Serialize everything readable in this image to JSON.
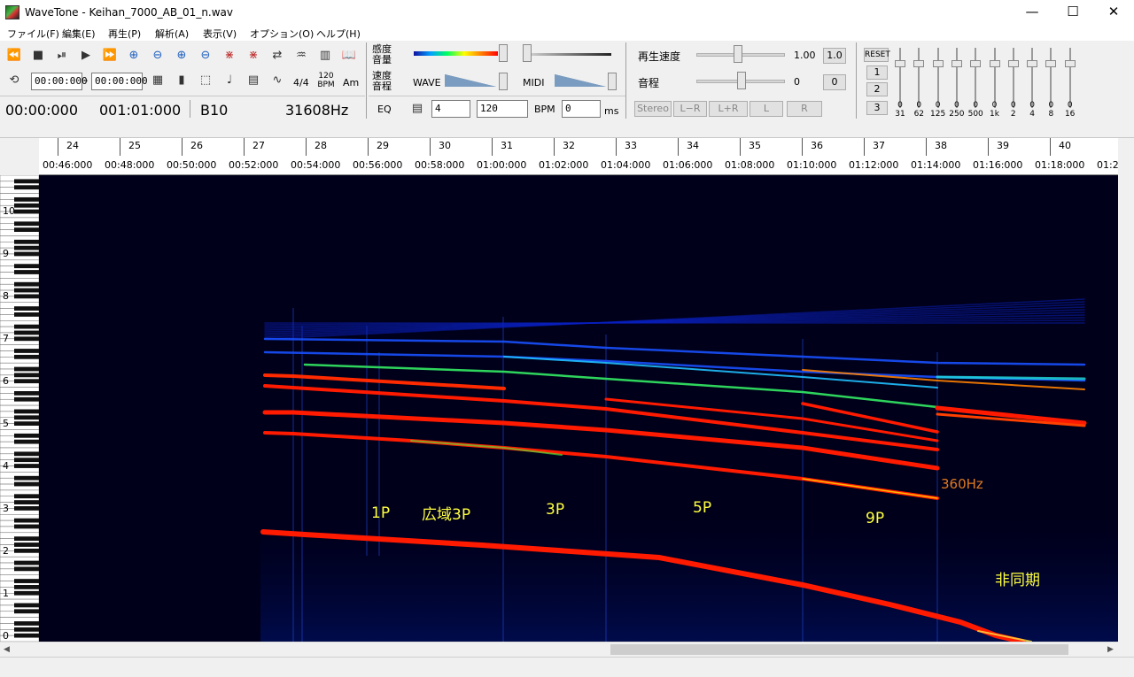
{
  "window": {
    "title": "WaveTone - Keihan_7000_AB_01_n.wav",
    "minimize": "—",
    "maximize": "☐",
    "close": "✕"
  },
  "menu": [
    "ファイル(F)",
    "編集(E)",
    "再生(P)",
    "解析(A)",
    "表示(V)",
    "オプション(O)",
    "ヘルプ(H)"
  ],
  "toolbar": {
    "time_start": "00:00:000",
    "time_sep": "–",
    "time_end": "00:00:000",
    "meter": "4/4",
    "bpm_icon_top": "120",
    "bpm_icon_bottom": "BPM",
    "am": "Am",
    "current_time": "00:00:000",
    "current_beat": "001:01:000",
    "current_note": "B10",
    "current_freq": "31608Hz"
  },
  "display": {
    "sensitivity_label_1": "感度",
    "sensitivity_label_2": "音量",
    "speed_label_1": "速度",
    "speed_label_2": "音程",
    "wave_label": "WAVE",
    "midi_label": "MIDI",
    "eq_label": "EQ",
    "beats_value": "4",
    "bpm_value": "120",
    "bpm_label": "BPM",
    "ms_value": "0",
    "ms_label": "ms"
  },
  "playback": {
    "speed_label": "再生速度",
    "speed_value": "1.00",
    "speed_reset": "1.0",
    "pitch_label": "音程",
    "pitch_value": "0",
    "pitch_reset": "0",
    "stereo": "Stereo",
    "lr_minus": "L−R",
    "lr_plus": "L+R",
    "l": "L",
    "r": "R"
  },
  "eq": {
    "reset": "RESET",
    "presets": [
      "1",
      "2",
      "3"
    ],
    "bands": [
      {
        "value": "0",
        "freq": "31"
      },
      {
        "value": "0",
        "freq": "62"
      },
      {
        "value": "0",
        "freq": "125"
      },
      {
        "value": "0",
        "freq": "250"
      },
      {
        "value": "0",
        "freq": "500"
      },
      {
        "value": "0",
        "freq": "1k"
      },
      {
        "value": "0",
        "freq": "2"
      },
      {
        "value": "0",
        "freq": "4"
      },
      {
        "value": "0",
        "freq": "8"
      },
      {
        "value": "0",
        "freq": "16"
      }
    ]
  },
  "ruler": {
    "bars": [
      "24",
      "25",
      "26",
      "27",
      "28",
      "29",
      "30",
      "31",
      "32",
      "33",
      "34",
      "35",
      "36",
      "37",
      "38",
      "39",
      "40"
    ],
    "times": [
      "00:46:000",
      "00:48:000",
      "00:50:000",
      "00:52:000",
      "00:54:000",
      "00:56:000",
      "00:58:000",
      "01:00:000",
      "01:02:000",
      "01:04:000",
      "01:06:000",
      "01:08:000",
      "01:10:000",
      "01:12:000",
      "01:14:000",
      "01:16:000",
      "01:18:000",
      "01:2"
    ]
  },
  "piano_octaves": [
    "10",
    "9",
    "8",
    "7",
    "6",
    "5",
    "4",
    "3",
    "2",
    "1",
    "0"
  ],
  "annotations": [
    {
      "text": "1P",
      "color": "#ffff40"
    },
    {
      "text": "広域3P",
      "color": "#ffff40"
    },
    {
      "text": "3P",
      "color": "#ffff40"
    },
    {
      "text": "5P",
      "color": "#ffff40"
    },
    {
      "text": "9P",
      "color": "#ffff40"
    },
    {
      "text": "360Hz",
      "color": "#e07a20"
    },
    {
      "text": "非同期",
      "color": "#ffff40"
    }
  ]
}
